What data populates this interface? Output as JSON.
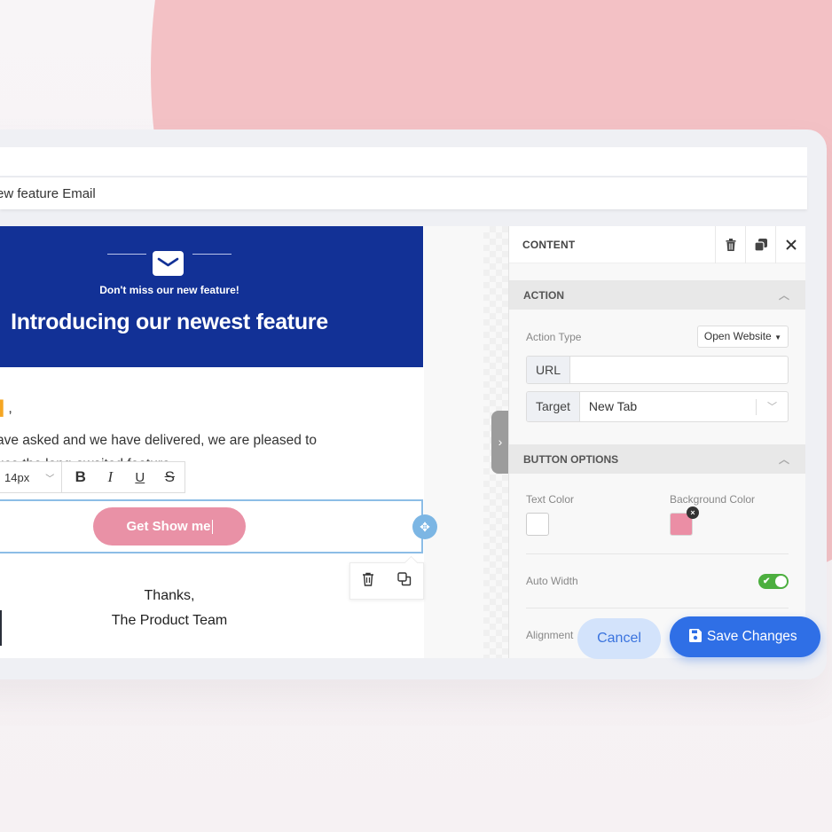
{
  "email": {
    "name_partial": "ew feature Email",
    "hero": {
      "icon": "mail-icon",
      "subtitle": "Don't miss our new feature!",
      "title": "Introducing our newest feature"
    },
    "greeting_suffix": ",",
    "body_line1": "ave asked and we have delivered, we are pleased to",
    "body_line2": "uce the long-awaited feature.",
    "cta_label": "Get Show me",
    "signoff_line1": "Thanks,",
    "signoff_line2": "The Product Team"
  },
  "rte_toolbar": {
    "font_size": "14px",
    "bold": "B",
    "italic": "I",
    "underline": "U",
    "strike": "S"
  },
  "colors": {
    "hero_bg": "#123196",
    "cta_bg": "#e991a6",
    "accent_blue": "#2f6fe6",
    "toggle_on": "#4caf3f",
    "merge_tag": "#f5a623"
  },
  "panel": {
    "title": "CONTENT",
    "action_section": {
      "title": "ACTION",
      "action_type_label": "Action Type",
      "action_type_value": "Open Website",
      "url_label": "URL",
      "url_value": "",
      "target_label": "Target",
      "target_value": "New Tab"
    },
    "button_options": {
      "title": "BUTTON OPTIONS",
      "text_color_label": "Text Color",
      "text_color_value": "#ffffff",
      "background_color_label": "Background Color",
      "background_color_value": "#eb8ea5",
      "auto_width_label": "Auto Width",
      "auto_width_on": true,
      "alignment_label": "Alignment"
    }
  },
  "actions": {
    "cancel": "Cancel",
    "save": "Save Changes"
  }
}
